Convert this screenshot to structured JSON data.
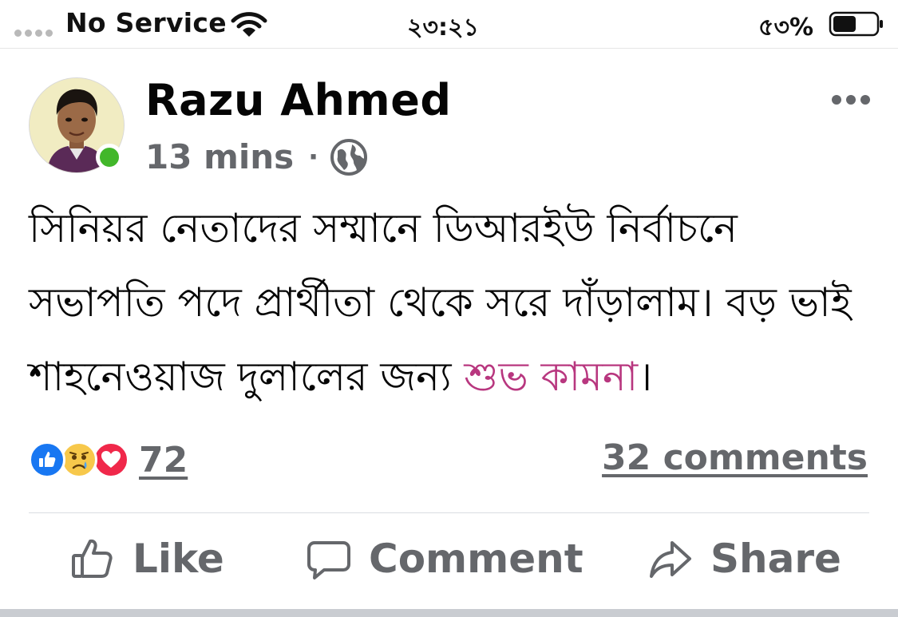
{
  "status_bar": {
    "carrier": "No Service",
    "time": "২৩:২১",
    "battery_percent": "৫৩%",
    "battery_level": 0.53
  },
  "post": {
    "author": "Razu Ahmed",
    "timestamp": "13 mins",
    "separator": "·",
    "privacy_icon": "globe-icon",
    "text_main": "সিনিয়র নেতাদের সম্মানে ডিআরইউ নির্বাচনে সভাপতি পদে প্রার্থীতা থেকে সরে দাঁড়ালাম। বড় ভাই শাহনেওয়াজ দুলালের জন্য ",
    "text_highlight": "শুভ কামনা",
    "text_end": "।",
    "highlight_color": "#b8377f",
    "author_online": true
  },
  "reactions": {
    "types": [
      "like-reaction-icon",
      "sad-reaction-icon",
      "love-reaction-icon"
    ],
    "count": "72"
  },
  "comments": {
    "count_label": "32 comments"
  },
  "actions": {
    "like": "Like",
    "comment": "Comment",
    "share": "Share"
  },
  "colors": {
    "like_blue": "#1877f2",
    "love_red": "#f0284a",
    "online_green": "#42b72a",
    "secondary_text": "#65676b"
  }
}
